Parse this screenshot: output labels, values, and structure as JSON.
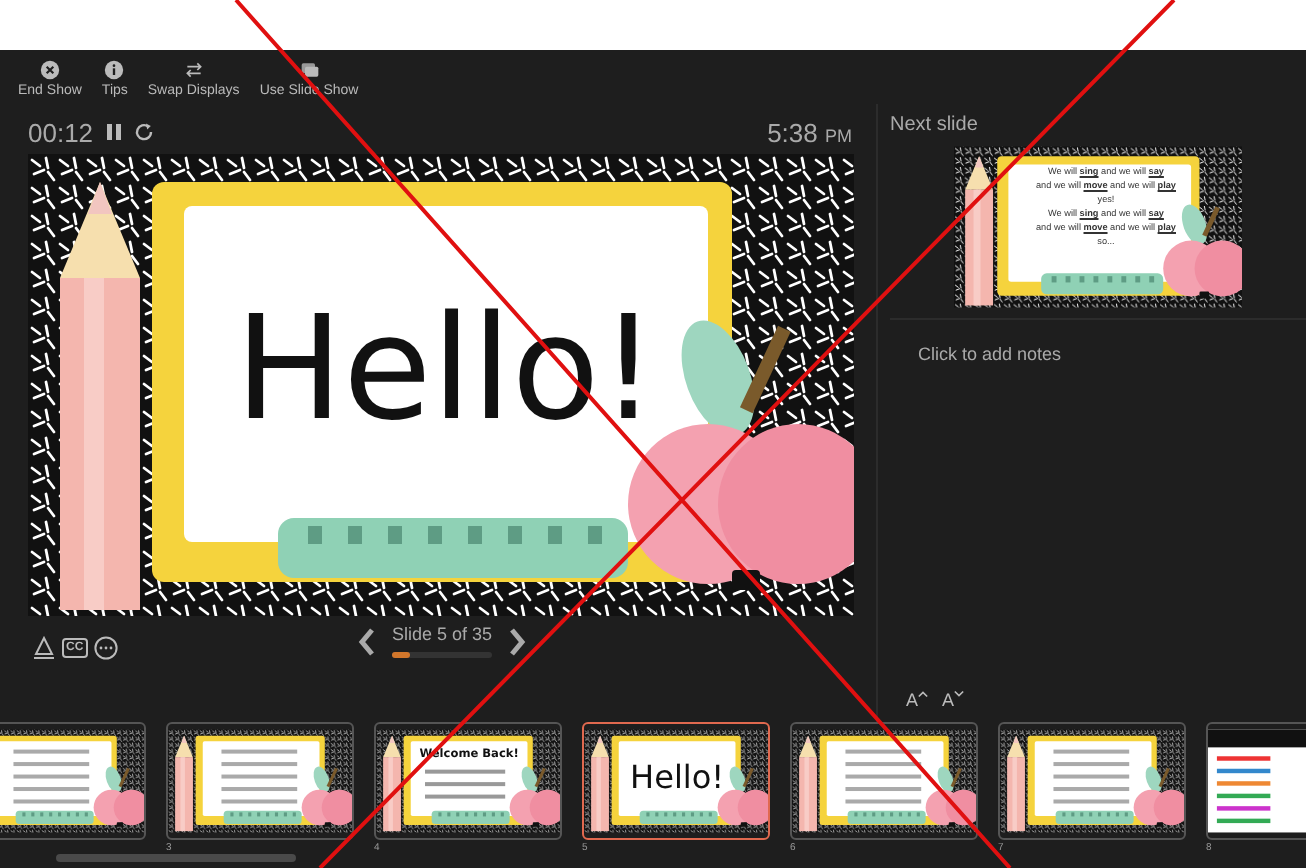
{
  "toolbar": [
    {
      "kind": "close",
      "label": "End Show"
    },
    {
      "kind": "info",
      "label": "Tips"
    },
    {
      "kind": "swap",
      "label": "Swap Displays"
    },
    {
      "kind": "screens",
      "label": "Use Slide Show"
    }
  ],
  "timer": {
    "time": "00:12",
    "clock": "5:38",
    "clock_suffix": "PM"
  },
  "current_slide": {
    "title": "Hello!"
  },
  "slide_tools": [
    {
      "kind": "laser"
    },
    {
      "kind": "captions",
      "label": "CC"
    },
    {
      "kind": "more"
    }
  ],
  "navigation": {
    "label": "Slide 5 of 35",
    "level": 0.18
  },
  "next_slide": {
    "heading": "Next slide",
    "lines": [
      "We will **sing** and we will **say**",
      "and we will **move** and we will **play**",
      "yes!",
      "We will **sing** and we will **say**",
      "and we will **move** and we will **play**",
      "so..."
    ]
  },
  "notes": {
    "placeholder": "Click to add notes"
  },
  "font_buttons": [
    {
      "kind": "bigger",
      "label": "A"
    },
    {
      "kind": "smaller",
      "label": "A"
    }
  ],
  "thumbnails": [
    {
      "kind": "plain",
      "selected": false
    },
    {
      "number": "3",
      "kind": "plain",
      "selected": false
    },
    {
      "number": "4",
      "kind": "title",
      "title": "Welcome Back!",
      "selected": false
    },
    {
      "number": "5",
      "kind": "hello",
      "title": "Hello!",
      "selected": true
    },
    {
      "number": "6",
      "kind": "plain",
      "selected": false
    },
    {
      "number": "7",
      "kind": "plain",
      "selected": false
    },
    {
      "number": "8",
      "kind": "white",
      "selected": false
    }
  ]
}
